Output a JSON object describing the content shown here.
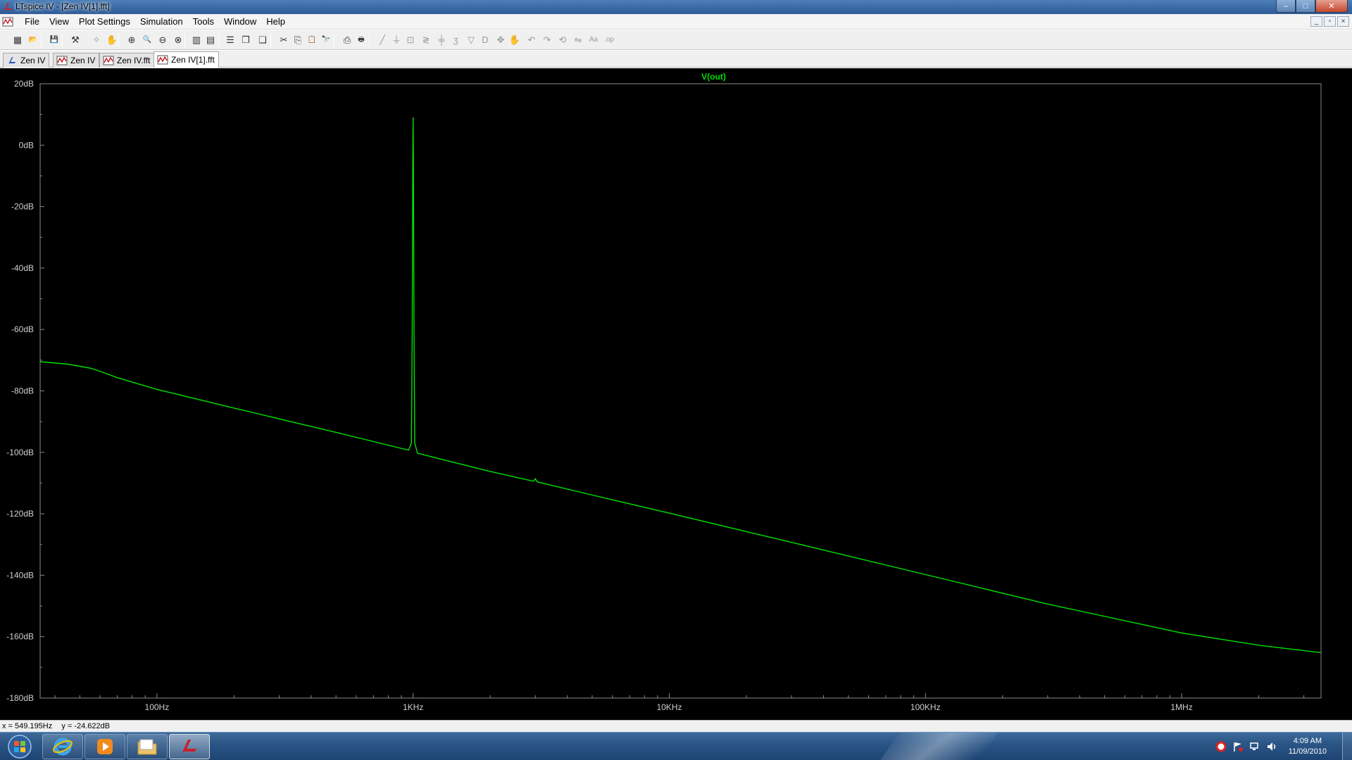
{
  "window": {
    "title": "LTspice IV - [Zen IV[1].fft]",
    "controls": {
      "minimize": "–",
      "maximize": "□",
      "close": "✕"
    }
  },
  "menu": {
    "items": [
      "File",
      "View",
      "Plot Settings",
      "Simulation",
      "Tools",
      "Window",
      "Help"
    ]
  },
  "mdi_controls": {
    "minimize": "_",
    "restore": "▫",
    "close": "×"
  },
  "toolbar": {
    "icons": [
      {
        "name": "new-schematic-icon",
        "glyph": "▦"
      },
      {
        "name": "open-icon",
        "glyph": "📂"
      },
      {
        "name": "save-icon",
        "glyph": "💾"
      },
      {
        "name": "control-panel-icon",
        "glyph": "⚒"
      },
      {
        "name": "run-icon",
        "glyph": "✧"
      },
      {
        "name": "halt-icon",
        "glyph": "✋"
      },
      {
        "name": "zoom-in-icon",
        "glyph": "⊕"
      },
      {
        "name": "zoom-area-icon",
        "glyph": "🔍"
      },
      {
        "name": "zoom-out-icon",
        "glyph": "⊖"
      },
      {
        "name": "zoom-fit-icon",
        "glyph": "⊗"
      },
      {
        "name": "autorange-icon",
        "glyph": "▥"
      },
      {
        "name": "pick-traces-icon",
        "glyph": "▤"
      },
      {
        "name": "tile-horizontal-icon",
        "glyph": "☰"
      },
      {
        "name": "tile-vertical-icon",
        "glyph": "❐"
      },
      {
        "name": "cascade-icon",
        "glyph": "❏"
      },
      {
        "name": "cut-icon",
        "glyph": "✂"
      },
      {
        "name": "copy-icon",
        "glyph": "⎘"
      },
      {
        "name": "paste-icon",
        "glyph": "📋"
      },
      {
        "name": "find-icon",
        "glyph": "🔭"
      },
      {
        "name": "print-icon",
        "glyph": "⎙"
      },
      {
        "name": "print-preview-icon",
        "glyph": "🖶"
      },
      {
        "name": "draw-wire-icon",
        "glyph": "╱"
      },
      {
        "name": "ground-icon",
        "glyph": "⏚"
      },
      {
        "name": "label-net-icon",
        "glyph": "⊡"
      },
      {
        "name": "resistor-icon",
        "glyph": "≷"
      },
      {
        "name": "capacitor-icon",
        "glyph": "╪"
      },
      {
        "name": "inductor-icon",
        "glyph": "ʒ"
      },
      {
        "name": "diode-icon",
        "glyph": "▽"
      },
      {
        "name": "component-icon",
        "glyph": "D"
      },
      {
        "name": "move-icon",
        "glyph": "✥"
      },
      {
        "name": "drag-icon",
        "glyph": "✋"
      },
      {
        "name": "undo-icon",
        "glyph": "↶"
      },
      {
        "name": "redo-icon",
        "glyph": "↷"
      },
      {
        "name": "rotate-icon",
        "glyph": "⟲"
      },
      {
        "name": "mirror-icon",
        "glyph": "⇋"
      },
      {
        "name": "text-icon",
        "glyph": "Aa"
      },
      {
        "name": "spice-directive-icon",
        "glyph": ".op"
      }
    ]
  },
  "tabs": [
    {
      "label": "Zen IV",
      "icon": "schematic-icon",
      "active": false
    },
    {
      "label": "Zen IV",
      "icon": "waveform-icon",
      "active": false
    },
    {
      "label": "Zen IV.fft",
      "icon": "waveform-icon",
      "active": false
    },
    {
      "label": "Zen IV[1].fft",
      "icon": "waveform-icon",
      "active": true
    }
  ],
  "status": {
    "x_readout": "x = 549.195Hz",
    "y_readout": "y = -24.622dB"
  },
  "taskbar": {
    "clock_time": "4:09 AM",
    "clock_date": "11/09/2010"
  },
  "colors": {
    "trace": "#00e000",
    "plot_bg": "#000000",
    "axis_text": "#cfcfcf",
    "grid_tick": "#8a8a8a"
  },
  "chart_data": {
    "type": "line",
    "title": "V(out)",
    "xlabel": "",
    "ylabel": "",
    "x_scale": "log",
    "xlim": [
      35,
      3500000
    ],
    "ylim": [
      -180,
      20
    ],
    "x_ticks": [
      {
        "value": 100,
        "label": "100Hz"
      },
      {
        "value": 1000,
        "label": "1KHz"
      },
      {
        "value": 10000,
        "label": "10KHz"
      },
      {
        "value": 100000,
        "label": "100KHz"
      },
      {
        "value": 1000000,
        "label": "1MHz"
      }
    ],
    "y_ticks": [
      {
        "value": 20,
        "label": "20dB"
      },
      {
        "value": 0,
        "label": "0dB"
      },
      {
        "value": -20,
        "label": "-20dB"
      },
      {
        "value": -40,
        "label": "-40dB"
      },
      {
        "value": -60,
        "label": "-60dB"
      },
      {
        "value": -80,
        "label": "-80dB"
      },
      {
        "value": -100,
        "label": "-100dB"
      },
      {
        "value": -120,
        "label": "-120dB"
      },
      {
        "value": -140,
        "label": "-140dB"
      },
      {
        "value": -160,
        "label": "-160dB"
      },
      {
        "value": -180,
        "label": "-180dB"
      }
    ],
    "grid": false,
    "series": [
      {
        "name": "V(out)",
        "x": [
          35,
          45,
          55,
          60,
          70,
          100,
          200,
          500,
          960,
          985,
          992,
          997,
          1000,
          1003,
          1008,
          1015,
          1040,
          2000,
          2950,
          3000,
          3050,
          5000,
          10000,
          30000,
          100000,
          300000,
          1000000,
          2000000,
          3500000
        ],
        "y": [
          -70.5,
          -71.3,
          -72.6,
          -73.6,
          -75.7,
          -79.5,
          -85.6,
          -93.5,
          -99.3,
          -97,
          -60,
          -5,
          9,
          -5,
          -60,
          -97,
          -100.3,
          -106.2,
          -109.4,
          -108.6,
          -109.6,
          -113.9,
          -119.8,
          -129.3,
          -139.8,
          -149.4,
          -158.8,
          -162.8,
          -165.2
        ]
      }
    ]
  }
}
